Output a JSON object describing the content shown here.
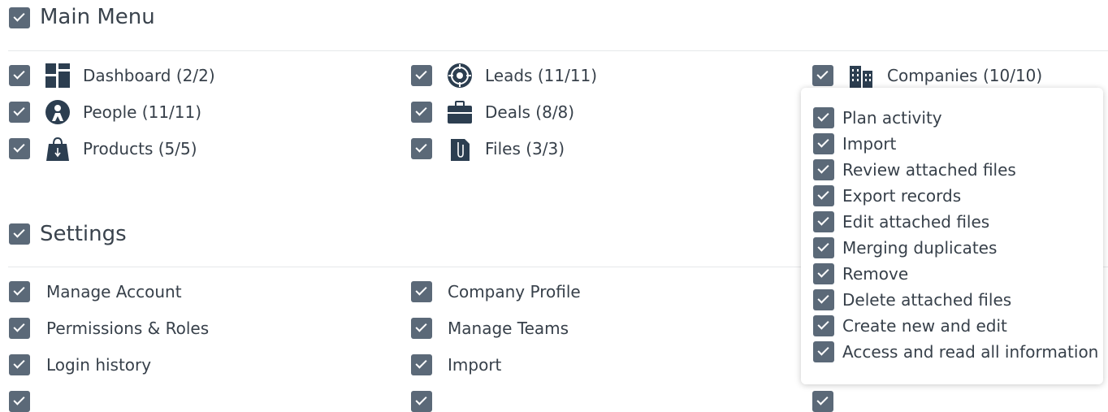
{
  "sections": {
    "main_menu": {
      "title": "Main Menu"
    },
    "settings": {
      "title": "Settings"
    }
  },
  "main_menu_items": [
    {
      "label": "Dashboard (2/2)",
      "icon": "dashboard-icon"
    },
    {
      "label": "Leads (11/11)",
      "icon": "target-icon"
    },
    {
      "label": "Companies (10/10)",
      "icon": "buildings-icon"
    },
    {
      "label": "People (11/11)",
      "icon": "person-icon"
    },
    {
      "label": "Deals (8/8)",
      "icon": "briefcase-icon"
    },
    {
      "label": "Products (5/5)",
      "icon": "shopping-bag-icon"
    },
    {
      "label": "Files (3/3)",
      "icon": "paperclip-file-icon"
    }
  ],
  "settings_items": [
    {
      "label": "Manage Account"
    },
    {
      "label": "Company Profile"
    },
    {
      "label": "Permissions & Roles"
    },
    {
      "label": "Manage Teams"
    },
    {
      "label": "Login history"
    },
    {
      "label": "Import"
    }
  ],
  "popup_items": [
    "Plan activity",
    "Import",
    "Review attached files",
    "Export records",
    "Edit attached files",
    "Merging duplicates",
    "Remove",
    "Delete attached files",
    "Create new and edit",
    "Access and read all information"
  ],
  "colors": {
    "checkbox": "#5b6978",
    "icon": "#2c3e50",
    "text": "#37404a"
  }
}
